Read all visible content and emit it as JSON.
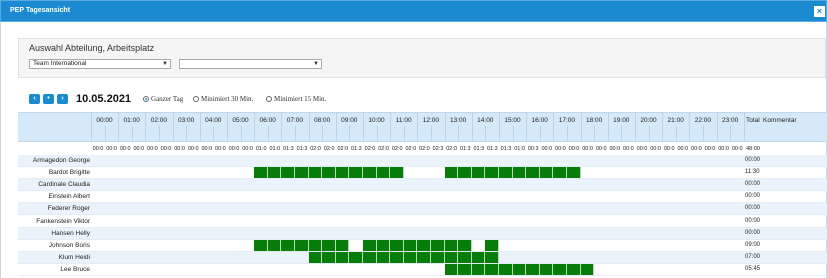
{
  "window": {
    "title": "PEP Tagesansicht",
    "close_label": "×"
  },
  "filter": {
    "title": "Auswahl Abteilung, Arbeitsplatz",
    "department_value": "Team International",
    "workplace_value": ""
  },
  "nav": {
    "prev": "‹",
    "today": "•",
    "next": "›"
  },
  "date": "10.05.2021",
  "view_options": [
    {
      "label": "Ganzer Tag",
      "selected": true
    },
    {
      "label": "Minimiert 30 Min.",
      "selected": false
    },
    {
      "label": "Minimiert 15 Min.",
      "selected": false
    }
  ],
  "hours": [
    "00:00",
    "01:00",
    "02:00",
    "03:00",
    "04:00",
    "05:00",
    "06:00",
    "07:00",
    "08:00",
    "09:00",
    "10:00",
    "11:00",
    "12:00",
    "13:00",
    "14:00",
    "15:00",
    "16:00",
    "17:00",
    "18:00",
    "19:00",
    "20:00",
    "21:00",
    "22:00",
    "23:00"
  ],
  "head_total": "Total",
  "head_comment": "Kommentar",
  "slot_totals": [
    "00:0",
    "00:0",
    "00:0",
    "00:0",
    "00:0",
    "00:0",
    "00:0",
    "00:0",
    "00:0",
    "00:0",
    "00:0",
    "00:0",
    "01:0",
    "01:0",
    "01:3",
    "01:3",
    "02:0",
    "02:0",
    "02:0",
    "01:3",
    "02:0",
    "02:0",
    "02:0",
    "02:0",
    "02:0",
    "02:3",
    "02:0",
    "01:3",
    "01:3",
    "01:3",
    "01:3",
    "01:0",
    "00:3",
    "00:0",
    "00:0",
    "00:0",
    "00:0",
    "00:0",
    "00:0",
    "00:0",
    "00:0",
    "00:0",
    "00:0",
    "00:0",
    "00:0",
    "00:0",
    "00:0",
    "00:0"
  ],
  "grand_total": "48:00",
  "status_colors": {
    "scheduled": "#087c08"
  },
  "employees": [
    {
      "name": "Armagedon George",
      "total": "00:00",
      "slots": []
    },
    {
      "name": "Bardot Brigitte",
      "total": "11:30",
      "slots": [
        12,
        13,
        14,
        15,
        16,
        17,
        18,
        19,
        20,
        21,
        22,
        26,
        27,
        28,
        29,
        30,
        31,
        32,
        33,
        34,
        35
      ]
    },
    {
      "name": "Cardinale Claudia",
      "total": "00:00",
      "slots": []
    },
    {
      "name": "Einstein Albert",
      "total": "00:00",
      "slots": []
    },
    {
      "name": "Federer Roger",
      "total": "00:00",
      "slots": []
    },
    {
      "name": "Fankenstein Viktor",
      "total": "00:00",
      "slots": []
    },
    {
      "name": "Hansen Helly",
      "total": "00:00",
      "slots": []
    },
    {
      "name": "Johnson Boris",
      "total": "09:00",
      "slots": [
        12,
        13,
        14,
        15,
        16,
        17,
        18,
        20,
        21,
        22,
        23,
        24,
        25,
        26,
        27,
        29
      ]
    },
    {
      "name": "Klum Heidi",
      "total": "07:00",
      "slots": [
        16,
        17,
        18,
        19,
        20,
        21,
        22,
        23,
        24,
        25,
        26,
        27,
        28,
        29
      ]
    },
    {
      "name": "Lee Bruce",
      "total": "05:45",
      "slots": [
        26,
        27,
        28,
        29,
        30,
        31,
        32,
        33,
        34,
        35,
        36
      ]
    }
  ]
}
